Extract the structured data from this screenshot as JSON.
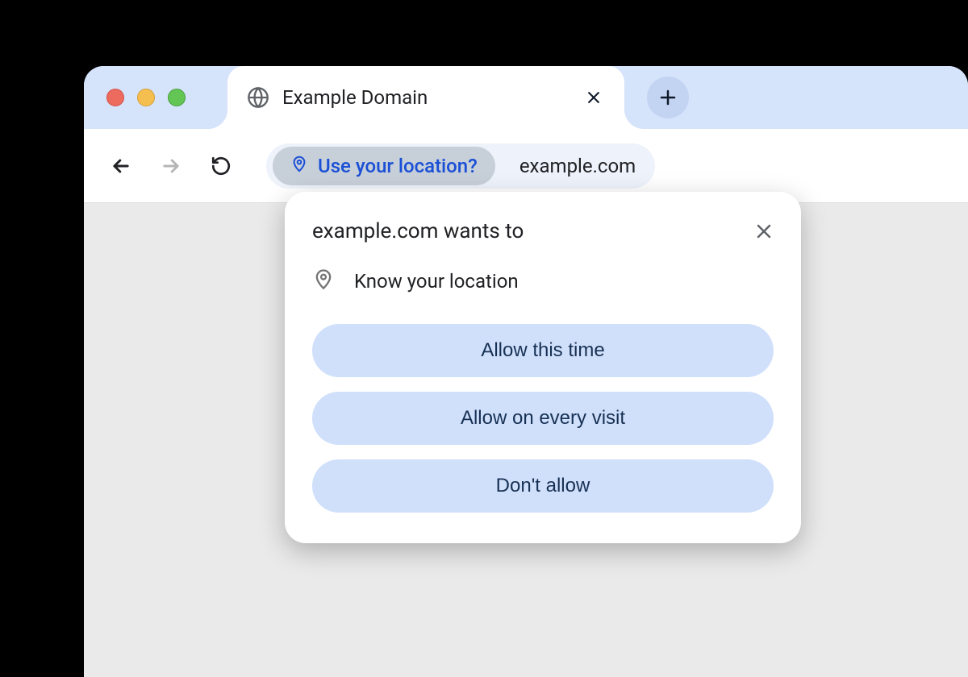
{
  "tab": {
    "title": "Example Domain"
  },
  "toolbar": {
    "chip_label": "Use your location?",
    "url": "example.com"
  },
  "popup": {
    "title": "example.com wants to",
    "permission_label": "Know your location",
    "buttons": {
      "allow_once": "Allow this time",
      "allow_always": "Allow on every visit",
      "deny": "Don't allow"
    }
  }
}
